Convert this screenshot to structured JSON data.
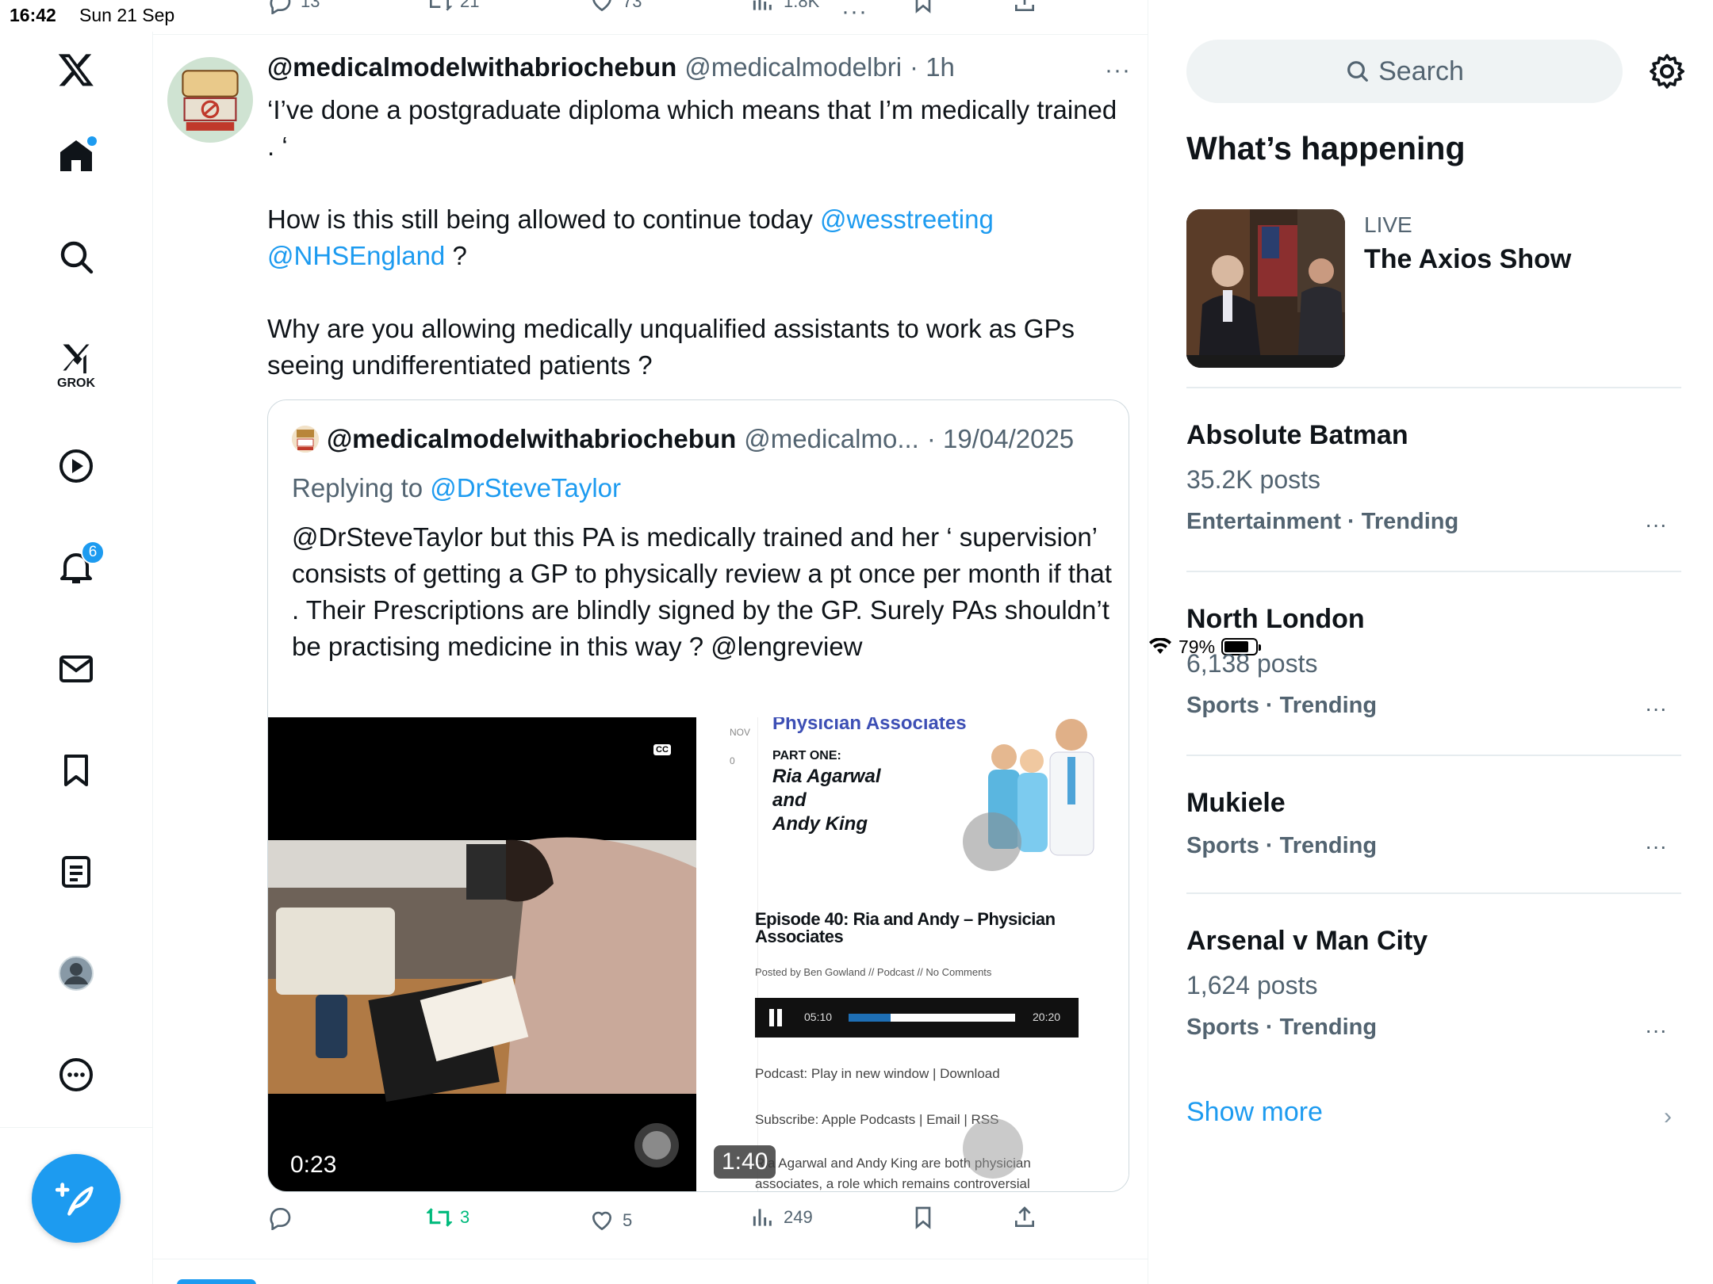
{
  "status": {
    "time": "16:42",
    "date": "Sun 21 Sep",
    "battery": "79%",
    "battery_level": 0.79
  },
  "nav": {
    "grok_label": "GROK",
    "notifications_count": "6"
  },
  "prev_tweet": {
    "replies": "13",
    "reposts": "21",
    "likes": "73",
    "views": "1.8K"
  },
  "tweet": {
    "name": "@medicalmodelwithabriochebun",
    "handle": "@medicalmodelbri",
    "time": "· 1h",
    "more": "···",
    "text1": "‘I’ve done a postgraduate diploma which means that I’m medically trained . ‘",
    "text2": "How is this still being allowed to continue today ",
    "mention1": "@wesstreeting",
    "mention2": "@NHSEngland",
    "text2b": " ?",
    "text3": "Why are you allowing medically unqualified assistants to work as GPs seeing undifferentiated patients ?",
    "replies": "",
    "reposts": "3",
    "likes": "5",
    "views": "249"
  },
  "quote": {
    "name": "@medicalmodelwithabriochebun",
    "handle": "@medicalmo...",
    "date": "· 19/04/2025",
    "replying_prefix": "Replying to ",
    "replying_to": "@DrSteveTaylor",
    "text": "@DrSteveTaylor but this PA is medically trained and her ‘ supervision’ consists of getting a GP to physically review a pt once per month if that . Their Prescriptions are blindly signed by the GP. Surely PAs shouldn’t be practising medicine in this way ? @lengreview",
    "video1_duration": "0:23",
    "video1_cc": "CC",
    "video2_duration": "1:40",
    "video2": {
      "nov": "NOV",
      "count": "0",
      "banner": "Physician Associates",
      "part": "PART ONE:",
      "names": [
        "Ria Agarwal",
        "and",
        "Andy King"
      ],
      "episode": "Episode 40: Ria and Andy – Physician Associates",
      "posted": "Posted by Ben Gowland // Podcast // No Comments",
      "time_now": "05:10",
      "time_total": "20:20",
      "podcast_line": "Podcast: Play in new window | Download",
      "subscribe_line": "Subscribe: Apple Podcasts | Email | RSS",
      "desc": "Ria Agarwal and Andy King are both physician associates, a role which remains controversial"
    }
  },
  "right": {
    "search_placeholder": "Search",
    "whats_happening": "What’s happening",
    "live_label": "LIVE",
    "live_title": "The Axios Show",
    "trends": [
      {
        "title": "Absolute Batman",
        "posts": "35.2K posts",
        "category": "Entertainment · Trending"
      },
      {
        "title": "North London",
        "posts": "6,138 posts",
        "category": "Sports · Trending"
      },
      {
        "title": "Mukiele",
        "posts": "",
        "category": "Sports · Trending"
      },
      {
        "title": "Arsenal v Man City",
        "posts": "1,624 posts",
        "category": "Sports · Trending"
      }
    ],
    "trend_more": "···",
    "show_more": "Show more"
  },
  "colors": {
    "accent": "#1d9bf0",
    "repost_active": "#00ba7c",
    "muted": "#536471"
  }
}
